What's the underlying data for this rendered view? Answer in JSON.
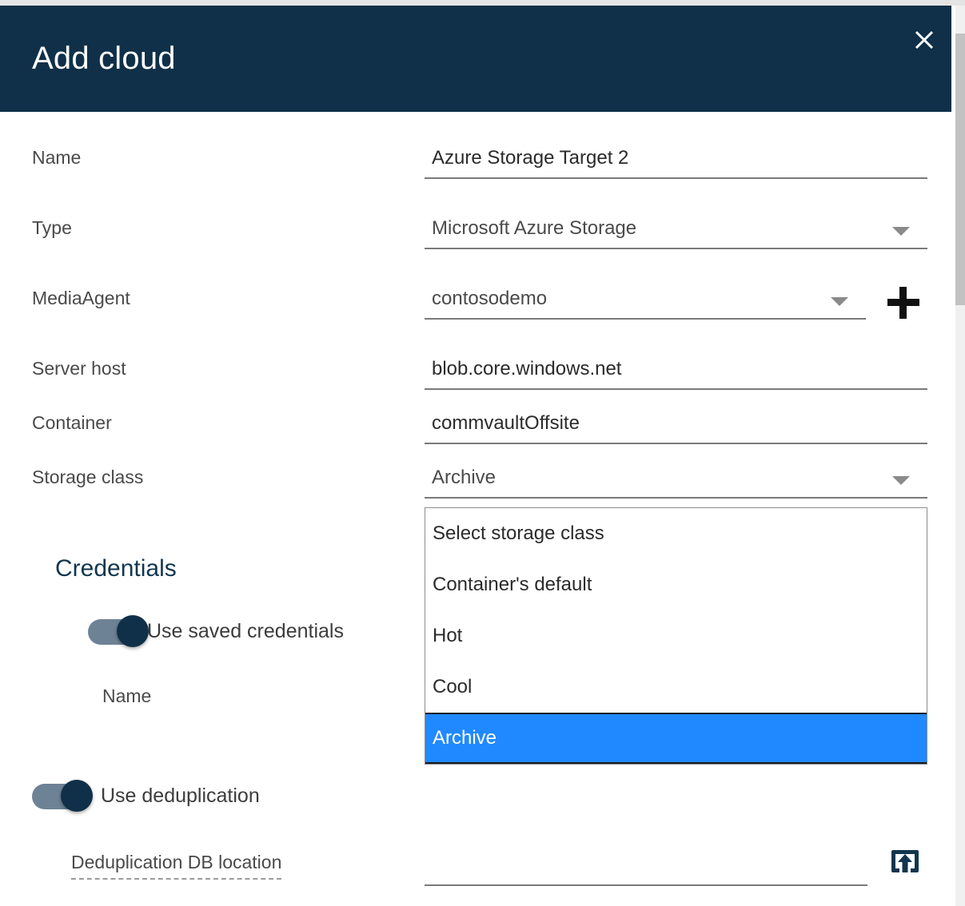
{
  "dialog": {
    "title": "Add cloud",
    "close_icon": "close-icon"
  },
  "fields": {
    "name": {
      "label": "Name",
      "value": "Azure Storage Target 2"
    },
    "type": {
      "label": "Type",
      "value": "Microsoft Azure Storage"
    },
    "media_agent": {
      "label": "MediaAgent",
      "value": "contosodemo",
      "add_icon": "plus-icon"
    },
    "server_host": {
      "label": "Server host",
      "value": "blob.core.windows.net"
    },
    "container": {
      "label": "Container",
      "value": "commvaultOffsite"
    },
    "storage_class": {
      "label": "Storage class",
      "value": "Archive"
    }
  },
  "storage_class_dropdown": {
    "options": [
      {
        "label": "Select storage class",
        "selected": false
      },
      {
        "label": "Container's default",
        "selected": false
      },
      {
        "label": "Hot",
        "selected": false
      },
      {
        "label": "Cool",
        "selected": false
      },
      {
        "label": "Archive",
        "selected": true
      }
    ],
    "highlight_color": "#2189ff"
  },
  "credentials": {
    "heading": "Credentials",
    "use_saved": {
      "label": "Use saved credentials",
      "state": "on"
    },
    "name_label": "Name"
  },
  "deduplication": {
    "use_dedup": {
      "label": "Use deduplication",
      "state": "on"
    },
    "db_location": {
      "label": "Deduplication DB location",
      "value": "",
      "browse_icon": "browse-upload-icon"
    }
  },
  "theme": {
    "header_bg": "#0f3048",
    "accent": "#12364f",
    "toggle_track": "#6e8296",
    "toggle_knob": "#0f3048"
  }
}
